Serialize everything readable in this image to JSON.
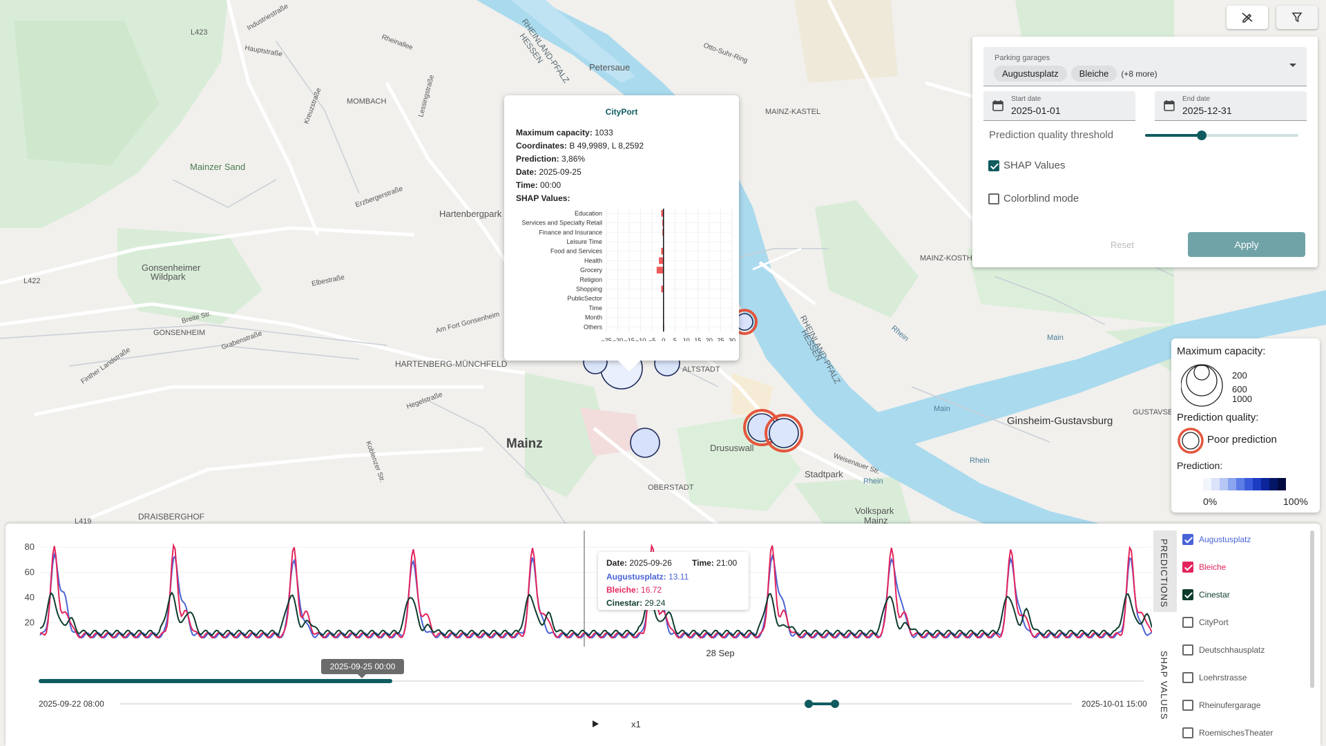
{
  "map": {
    "labels": {
      "mombach": "MOMBACH",
      "mainzer_sand": "Mainzer Sand",
      "hartenbergpark": "Hartenbergpark",
      "gonsenheimer_wildpark_1": "Gonsenheimer",
      "gonsenheimer_wildpark_2": "Wildpark",
      "gonsenheim": "GONSENHEIM",
      "hartenberg": "HARTENBERG-MÜNCHFELD",
      "mainz": "Mainz",
      "altstadt": "ALTSTADT",
      "oberstadt": "OBERSTADT",
      "drususwall": "Drususwall",
      "stadtpark": "Stadtpark",
      "volkspark_1": "Volkspark",
      "volkspark_2": "Mainz",
      "draisberghof": "DRAISBERGHOF",
      "petersaue": "Petersaue",
      "mainz_kastel": "MAINZ-KASTEL",
      "mainz_kostheim": "MAINZ-KOSTH",
      "ginsheim": "Ginsheim-Gustavsburg",
      "gustavsburg": "GUSTAVSB",
      "hessen_1": "HESSEN",
      "rlp_1": "RHEINLAND-PFALZ",
      "hessen_2": "HESSEN",
      "rlp_2": "RHEINLAND-PFALZ",
      "rhein_1": "Rhein",
      "rhein_2": "Rhein",
      "rhein_3": "Rhein",
      "main_1": "Main",
      "main_2": "Main",
      "l423": "L423",
      "l422": "L422",
      "l419": "L419",
      "road_industrie": "Industriestraße",
      "road_haupt": "Hauptstraße",
      "road_rheinallee": "Rheinallee",
      "road_elbe": "Elbestraße",
      "road_breite": "Breite Str.",
      "road_graben": "Grabenstraße",
      "road_finther": "Finther Landstraße",
      "road_hegel": "Hegelstraße",
      "road_koblenzer": "Koblenzer Str.",
      "road_otto": "Otto-Suhr-Ring",
      "road_fort": "Am Fort Gonsenheim",
      "road_weisenauer": "Weisenauer Str.",
      "road_kreuz": "Kreuzstraße",
      "road_erzberger": "Erzbergerstraße",
      "road_lessing": "Lessingstraße"
    },
    "markers": [
      {
        "name": "Augustusplatz",
        "fill": "#dce6fb",
        "poor": false
      },
      {
        "name": "CityPort",
        "fill": "#e9effc",
        "poor": false
      },
      {
        "name": "Deutschhausplatz",
        "fill": "#dce6fb",
        "poor": false
      },
      {
        "name": "Cinestar",
        "fill": "#d7e1fb",
        "poor": false
      },
      {
        "name": "Bleiche",
        "fill": "#d9e3fb",
        "poor": true
      },
      {
        "name": "Rheinufergarage",
        "fill": "#dce6fb",
        "poor": true
      },
      {
        "name": "Loehrstrasse",
        "fill": "#d9e3fb",
        "poor": true
      }
    ]
  },
  "top_buttons": {
    "magic_icon": "edit-off-icon",
    "filter_icon": "filter-icon"
  },
  "filter_panel": {
    "garages_label": "Parking garages",
    "garage_chips": [
      "Augustusplatz",
      "Bleiche"
    ],
    "more": "(+8 more)",
    "start_label": "Start date",
    "start_value": "2025-01-01",
    "end_label": "End date",
    "end_value": "2025-12-31",
    "threshold_label": "Prediction quality threshold",
    "threshold_value": 0.37,
    "shap_label": "SHAP Values",
    "shap_checked": true,
    "colorblind_label": "Colorblind mode",
    "colorblind_checked": false,
    "reset_label": "Reset",
    "apply_label": "Apply",
    "accent": "#0f5b5f"
  },
  "popup": {
    "title": "CityPort",
    "capacity_label": "Maximum capacity:",
    "capacity_value": "1033",
    "coords_label": "Coordinates:",
    "coords_value": "B 49,9989, L 8,2592",
    "prediction_label": "Prediction:",
    "prediction_value": "3,86%",
    "date_label": "Date:",
    "date_value": "2025-09-25",
    "time_label": "Time:",
    "time_value": "00:00",
    "shap_label": "SHAP Values:"
  },
  "chart_data": [
    {
      "type": "bar",
      "orientation": "horizontal",
      "categories": [
        "Education",
        "Services and Specialty Retail",
        "Finance and Insurance",
        "Leisure Time",
        "Food and Services",
        "Health",
        "Grocery",
        "Religion",
        "Shopping",
        "PublicSector",
        "Time",
        "Month",
        "Others"
      ],
      "values": [
        -1,
        -0.5,
        -0.5,
        0,
        -1,
        -2,
        -3,
        0,
        -1,
        0,
        0,
        0,
        0.3
      ],
      "xlim": [
        -25,
        30
      ],
      "xticks": [
        "−25",
        "−20",
        "−15",
        "−10",
        "−5",
        "0",
        "5",
        "10",
        "15",
        "20",
        "25",
        "30"
      ],
      "bar_color": "#ef5a5a",
      "grid": true
    },
    {
      "type": "line",
      "x_start": "2025-09-22 08:00",
      "x_end": "2025-10-01 15:00",
      "x_tick_label": "28 Sep",
      "ylim": [
        0,
        90
      ],
      "yticks": [
        "20",
        "40",
        "60",
        "80"
      ],
      "series": [
        {
          "name": "Augustusplatz",
          "color": "#4a63d6"
        },
        {
          "name": "Bleiche",
          "color": "#e3245c"
        },
        {
          "name": "Cinestar",
          "color": "#0d3b2e"
        }
      ],
      "daily_pattern": {
        "peak_hours": [
          1.5,
          3.5,
          5.5,
          8.5
        ],
        "days": 9.3
      },
      "hover": {
        "date_label": "Date:",
        "date_value": "2025-09-26",
        "time_label": "Time:",
        "time_value": "21:00",
        "rows": [
          {
            "name": "Augustusplatz",
            "value": "13.11",
            "color": "#4a63d6"
          },
          {
            "name": "Bleiche",
            "value": "16.72",
            "color": "#e3245c"
          },
          {
            "name": "Cinestar",
            "value": "29.24",
            "color": "#0d3b2e"
          }
        ]
      }
    }
  ],
  "legend": {
    "capacity_title": "Maximum capacity:",
    "capacity_values": [
      "200",
      "600",
      "1000"
    ],
    "quality_title": "Prediction quality:",
    "poor_label": "Poor prediction",
    "prediction_title": "Prediction:",
    "pred_min": "0%",
    "pred_max": "100%",
    "gradient": [
      "#f3f5fd",
      "#dbe3fb",
      "#b6c7f5",
      "#8aa4ef",
      "#5d7de6",
      "#3a5bd9",
      "#1d3cc4",
      "#0c2499",
      "#051566",
      "#020b3f"
    ]
  },
  "timeline": {
    "tooltip": "2025-09-25 00:00",
    "start_label": "2025-09-22 08:00",
    "end_label": "2025-10-01 15:00",
    "speed": "x1",
    "progress": 0.32
  },
  "side_tabs": {
    "predictions": "PREDICTIONS",
    "shap": "SHAP VALUES"
  },
  "series_list": [
    {
      "name": "Augustusplatz",
      "checked": true,
      "color": "#4a63d6"
    },
    {
      "name": "Bleiche",
      "checked": true,
      "color": "#e3245c"
    },
    {
      "name": "Cinestar",
      "checked": true,
      "color": "#0d3b2e"
    },
    {
      "name": "CityPort",
      "checked": false,
      "color": "#555555"
    },
    {
      "name": "Deutschhausplatz",
      "checked": false,
      "color": "#555555"
    },
    {
      "name": "Loehrstrasse",
      "checked": false,
      "color": "#555555"
    },
    {
      "name": "Rheinufergarage",
      "checked": false,
      "color": "#555555"
    },
    {
      "name": "RoemischesTheater",
      "checked": false,
      "color": "#555555"
    }
  ]
}
